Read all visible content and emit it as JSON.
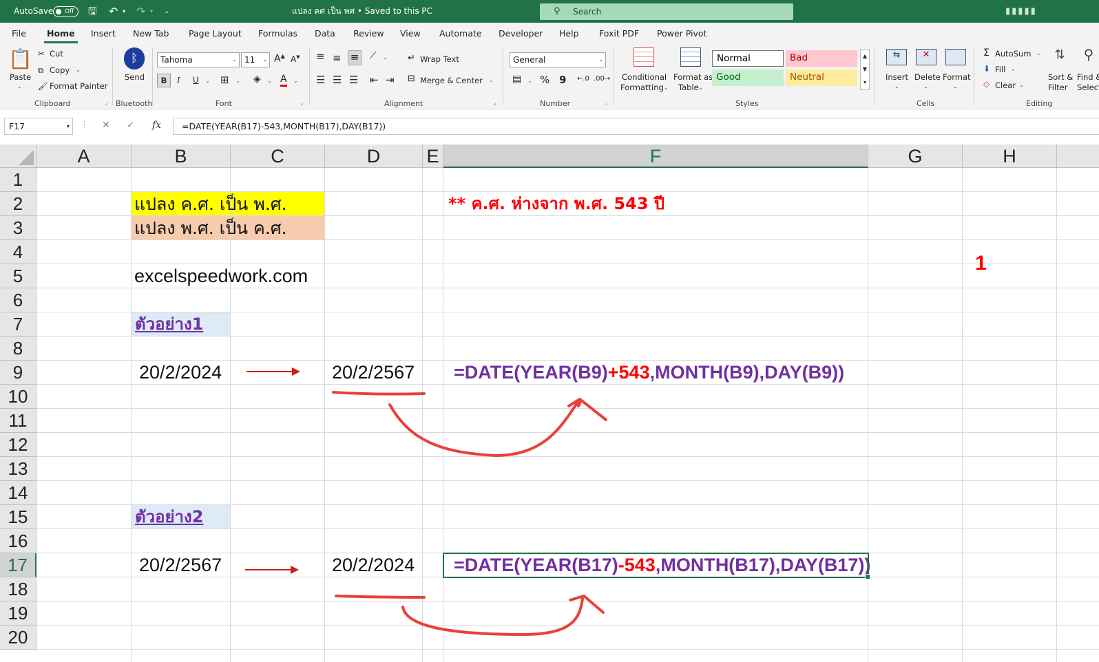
{
  "titlebar": {
    "autosave_label": "AutoSave",
    "autosave_state": "Off",
    "doc_title": "แปลง คศ เป็น พศ • Saved to this PC",
    "search_placeholder": "Search"
  },
  "tabs": [
    "File",
    "Home",
    "Insert",
    "New Tab",
    "Page Layout",
    "Formulas",
    "Data",
    "Review",
    "View",
    "Automate",
    "Developer",
    "Help",
    "Foxit PDF",
    "Power Pivot"
  ],
  "active_tab": "Home",
  "ribbon": {
    "clipboard": {
      "paste": "Paste",
      "cut": "Cut",
      "copy": "Copy",
      "format_painter": "Format Painter",
      "label": "Clipboard"
    },
    "bluetooth": {
      "send": "Send",
      "label": "Bluetooth"
    },
    "font": {
      "name": "Tahoma",
      "size": "11",
      "bold": "B",
      "italic": "I",
      "underline": "U",
      "label": "Font"
    },
    "alignment": {
      "wrap_text": "Wrap Text",
      "merge_center": "Merge & Center",
      "label": "Alignment"
    },
    "number": {
      "format": "General",
      "percent": "%",
      "comma": "9",
      "label": "Number"
    },
    "styles": {
      "conditional": [
        "Conditional",
        "Formatting"
      ],
      "format_as_table": [
        "Format as",
        "Table"
      ],
      "normal": "Normal",
      "bad": "Bad",
      "good": "Good",
      "neutral": "Neutral",
      "label": "Styles"
    },
    "cells": {
      "insert": "Insert",
      "delete": "Delete",
      "format": "Format",
      "label": "Cells"
    },
    "editing": {
      "autosum": "AutoSum",
      "fill": "Fill",
      "clear": "Clear",
      "sort": [
        "Sort &",
        "Filter"
      ],
      "find": [
        "Find &",
        "Select"
      ],
      "label": "Editing"
    }
  },
  "formula_bar": {
    "name_box": "F17",
    "formula": "=DATE(YEAR(B17)-543,MONTH(B17),DAY(B17))"
  },
  "columns": [
    "A",
    "B",
    "C",
    "D",
    "E",
    "F",
    "G",
    "H"
  ],
  "rows": [
    "1",
    "2",
    "3",
    "4",
    "5",
    "6",
    "7",
    "8",
    "9",
    "10",
    "11",
    "12",
    "13",
    "14",
    "15",
    "16",
    "17",
    "18",
    "19",
    "20"
  ],
  "cells": {
    "B2": "แปลง ค.ศ. เป็น พ.ศ.",
    "B3": "แปลง พ.ศ. เป็น ค.ศ.",
    "F2": "** ค.ศ. ห่างจาก พ.ศ.  543 ปี",
    "H5": "1",
    "B5": "excelspeedwork.com",
    "B7": "ตัวอย่าง1",
    "B9": "20/2/2024",
    "D9": "20/2/2567",
    "F9": {
      "pre": "=DATE(YEAR(B9)",
      "op": "+543",
      "post": ",MONTH(B9),DAY(B9))"
    },
    "B15": "ตัวอย่าง2",
    "B17": "20/2/2567",
    "D17": "20/2/2024",
    "F17": {
      "pre": "=DATE(YEAR(B17)",
      "op": "-543",
      "post": ",MONTH(B17),DAY(B17))"
    }
  },
  "colors": {
    "excel_green": "#217346",
    "highlight_yellow": "#ffff00",
    "highlight_peach": "#f8cbad",
    "header_blue": "#ddebf7",
    "formula_purple": "#7030a0",
    "annotation_red": "#e8413a"
  }
}
